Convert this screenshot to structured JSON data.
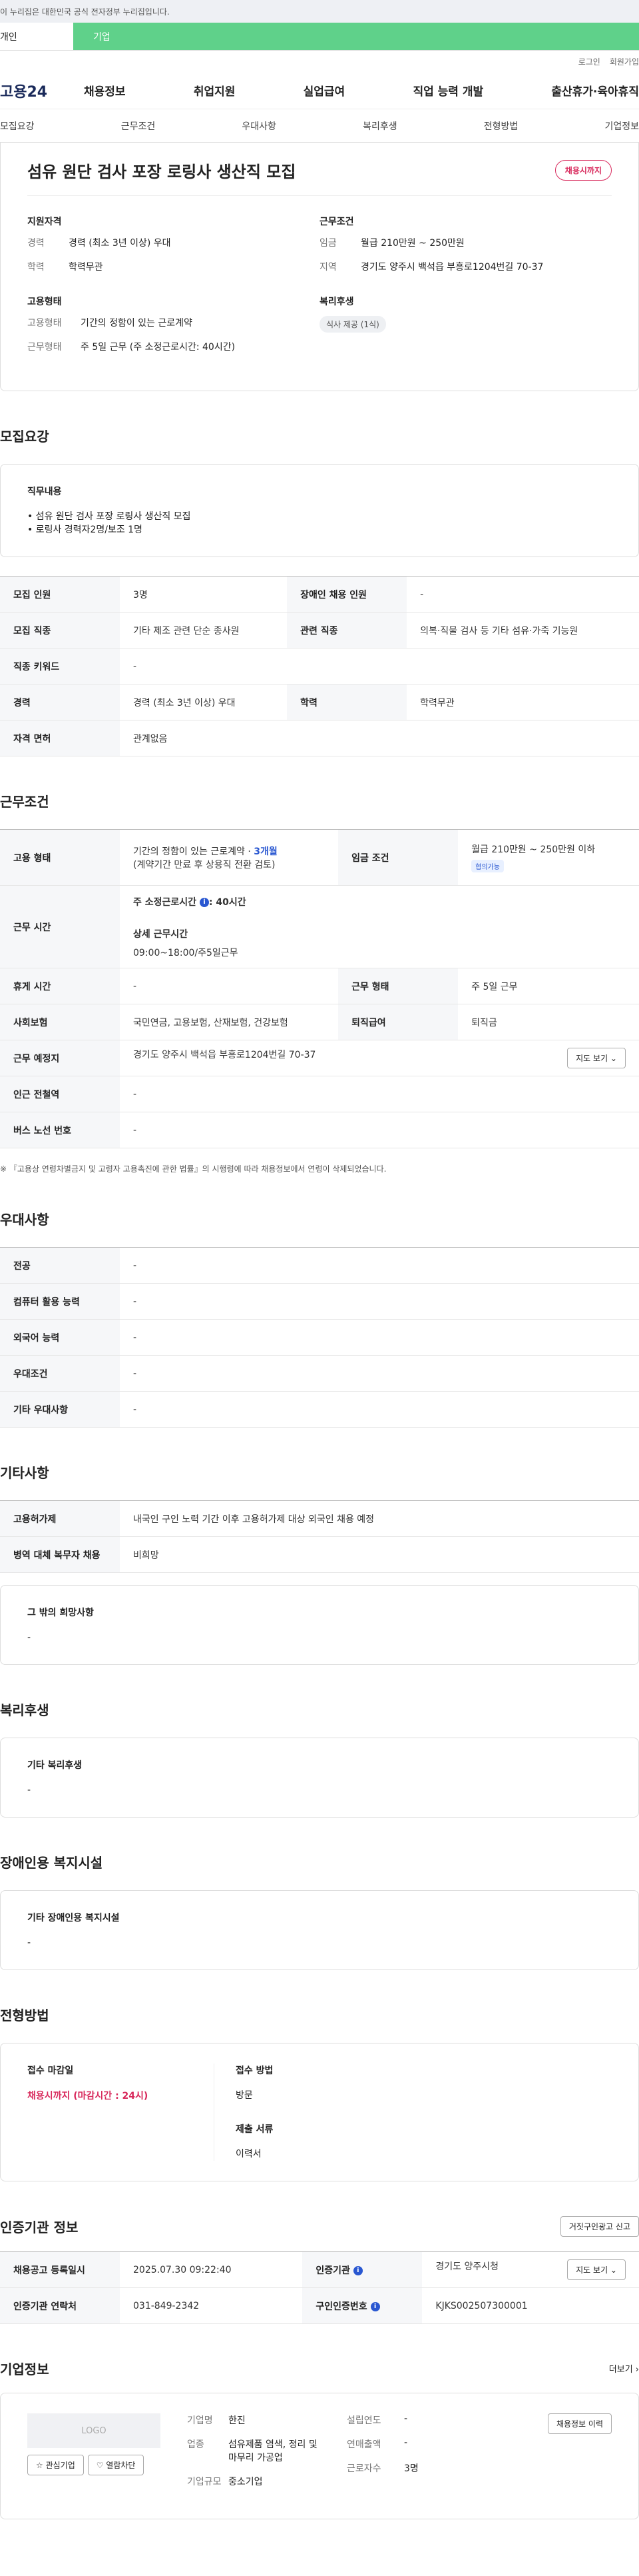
{
  "gov_banner": "이 누리집은 대한민국 공식 전자정부 누리집입니다.",
  "usertabs": [
    "개인",
    "기업"
  ],
  "util": [
    "로그인",
    "회원가입"
  ],
  "logo": "고용24",
  "gnb": [
    "채용정보",
    "취업지원",
    "실업급여",
    "직업 능력 개발",
    "출산휴가·육아휴직"
  ],
  "subnav": [
    "모집요강",
    "근무조건",
    "우대사항",
    "복리후생",
    "전형방법",
    "기업정보"
  ],
  "header": {
    "title": "섬유 원단 검사 포장 로링사 생산직 모집",
    "badge": "채용시까지",
    "qual_title": "지원자격",
    "career_k": "경력",
    "career_v": "경력 (최소 3년 이상) 우대",
    "edu_k": "학력",
    "edu_v": "학력무관",
    "cond_title": "근무조건",
    "wage_k": "임금",
    "wage_v": "월급 210만원 ~ 250만원",
    "loc_k": "지역",
    "loc_v": "경기도 양주시 백석읍 부흥로1204번길 70-37",
    "emp_title": "고용형태",
    "emptype_k": "고용형태",
    "emptype_v": "기간의 정함이 있는 근로계약",
    "worktype_k": "근무형태",
    "worktype_v": "주 5일 근무 (주 소정근로시간: 40시간)",
    "welfare_title": "복리후생",
    "welfare_chip": "식사 제공 (1식)"
  },
  "recruit": {
    "title": "모집요강",
    "duty_title": "직무내용",
    "duty_lines": [
      "• 섬유 원단 검사 포장 로링사 생산직 모집",
      "• 로링사 경력자2명/보조 1명"
    ],
    "rows": {
      "count_k": "모집 인원",
      "count_v": "3명",
      "disabled_k": "장애인 채용 인원",
      "disabled_v": "-",
      "job_k": "모집 직종",
      "job_v": "기타 제조 관련 단순 종사원",
      "rel_k": "관련 직종",
      "rel_v": "의복·직물 검사 등 기타 섬유·가죽 기능원",
      "kw_k": "직종 키워드",
      "kw_v": "-",
      "career_k": "경력",
      "career_v": "경력 (최소 3년 이상) 우대",
      "edu_k": "학력",
      "edu_v": "학력무관",
      "license_k": "자격 면허",
      "license_v": "관계없음"
    }
  },
  "work": {
    "title": "근무조건",
    "emp_k": "고용 형태",
    "emp_v1": "기간의 정함이 있는 근로계약 · ",
    "emp_v1b": "3개월",
    "emp_v2": "(계약기간 만료 후 상용직 전환 검토)",
    "wage_k": "임금 조건",
    "wage_v": "월급 210만원 ~ 250만원 이하",
    "wage_tag": "협의가능",
    "time_k": "근무 시간",
    "time_v1": "주 소정근로시간",
    "time_v1b": ": 40시간",
    "time_v2": "상세 근무시간",
    "time_v3": "09:00~18:00/주5일근무",
    "rest_k": "휴게 시간",
    "rest_v": "-",
    "form_k": "근무 형태",
    "form_v": "주 5일 근무",
    "ins_k": "사회보험",
    "ins_v": "국민연금, 고용보험, 산재보험, 건강보험",
    "ret_k": "퇴직급여",
    "ret_v": "퇴직금",
    "place_k": "근무 예정지",
    "place_v": "경기도 양주시 백석읍 부흥로1204번길 70-37",
    "map_btn": "지도 보기 ⌄",
    "subway_k": "인근 전철역",
    "subway_v": "-",
    "bus_k": "버스 노선 번호",
    "bus_v": "-",
    "note": "※ 『고용상 연령차별금지 및 고령자 고용촉진에 관한 법률』의 시행령에 따라 채용정보에서 연령이 삭제되었습니다."
  },
  "pref": {
    "title": "우대사항",
    "major_k": "전공",
    "major_v": "-",
    "pc_k": "컴퓨터 활용 능력",
    "pc_v": "-",
    "lang_k": "외국어 능력",
    "lang_v": "-",
    "pref_k": "우대조건",
    "pref_v": "-",
    "etc_k": "기타 우대사항",
    "etc_v": "-"
  },
  "etc": {
    "title": "기타사항",
    "permit_k": "고용허가제",
    "permit_v": "내국인 구인 노력 기간 이후 고용허가제 대상 외국인 채용 예정",
    "army_k": "병역 대체 복무자 채용",
    "army_v": "비희망",
    "wish_title": "그 밖의 희망사항",
    "wish_v": "-"
  },
  "welfare": {
    "title": "복리후생",
    "box_title": "기타 복리후생",
    "box_v": "-"
  },
  "facility": {
    "title": "장애인용 복지시설",
    "box_title": "기타 장애인용 복지시설",
    "box_v": "-"
  },
  "screening": {
    "title": "전형방법",
    "deadline_t": "접수 마감일",
    "deadline_v": "채용시까지 (마감시간 : 24시)",
    "method_t": "접수 방법",
    "method_v": "방문",
    "docs_t": "제출 서류",
    "docs_v": "이력서"
  },
  "cert": {
    "title": "인증기관 정보",
    "report_btn": "거짓구인광고 신고",
    "reg_k": "채용공고 등록일시",
    "reg_v": "2025.07.30 09:22:40",
    "org_k": "인증기관",
    "org_v": "경기도 양주시청",
    "map_btn": "지도 보기 ⌄",
    "tel_k": "인증기관 연락처",
    "tel_v": "031-849-2342",
    "no_k": "구인인증번호",
    "no_v": "KJKS002507300001"
  },
  "company": {
    "title": "기업정보",
    "more": "더보기 ›",
    "logo": "LOGO",
    "fav_btn": "☆ 관심기업",
    "block_btn": "♡ 열람차단",
    "name_k": "기업명",
    "name_v": "한진",
    "ind_k": "업종",
    "ind_v": "섬유제품 염색, 정리 및 마무리 가공업",
    "size_k": "기업규모",
    "size_v": "중소기업",
    "year_k": "설립연도",
    "year_v": "-",
    "sales_k": "연매출액",
    "sales_v": "-",
    "emp_k": "근로자수",
    "emp_v": "3명",
    "hist_btn": "채용정보 이력"
  }
}
